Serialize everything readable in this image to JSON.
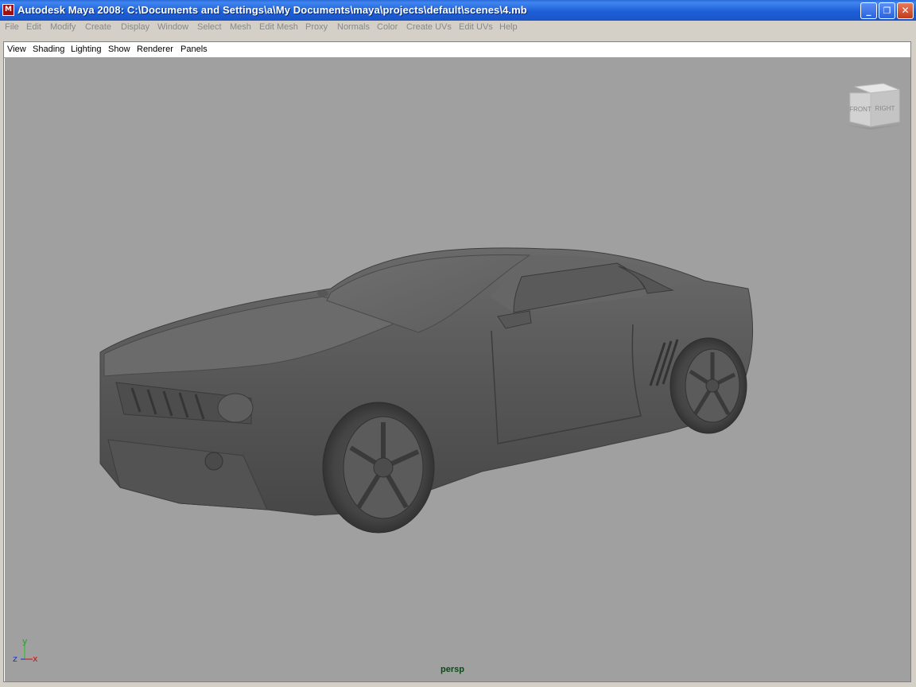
{
  "window": {
    "title": "Autodesk Maya 2008: C:\\Documents and Settings\\a\\My Documents\\maya\\projects\\default\\scenes\\4.mb",
    "controls": {
      "minimize": "_",
      "restore": "❐",
      "close": "✕"
    }
  },
  "main_menu": [
    "File",
    "Edit",
    "Modify",
    "Create",
    "Display",
    "Window",
    "Select",
    "Mesh",
    "Edit Mesh",
    "Proxy",
    "Normals",
    "Color",
    "Create UVs",
    "Edit UVs",
    "Help"
  ],
  "panel_menu": [
    "View",
    "Shading",
    "Lighting",
    "Show",
    "Renderer",
    "Panels"
  ],
  "viewport": {
    "camera_name": "persp",
    "view_cube": {
      "front_label": "FRONT",
      "right_label": "RIGHT"
    },
    "axes": {
      "x": "x",
      "y": "y",
      "z": "z"
    },
    "background_color": "#a0a0a0"
  },
  "colors": {
    "titlebar": "#1d5fd6",
    "menu_disabled_text": "#888888",
    "camera_label": "#0b4a16"
  }
}
